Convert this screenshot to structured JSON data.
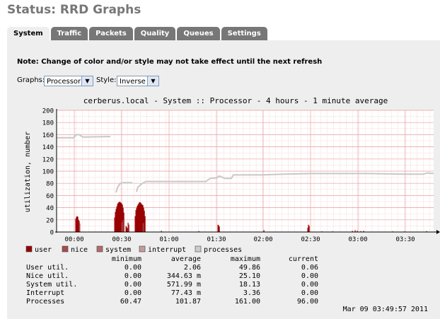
{
  "page": {
    "title": "Status: RRD Graphs"
  },
  "tabs": [
    {
      "label": "System",
      "active": true
    },
    {
      "label": "Traffic",
      "active": false
    },
    {
      "label": "Packets",
      "active": false
    },
    {
      "label": "Quality",
      "active": false
    },
    {
      "label": "Queues",
      "active": false
    },
    {
      "label": "Settings",
      "active": false
    }
  ],
  "note": "Note: Change of color and/or style may not take effect until the next refresh",
  "controls": {
    "graphs_label": "Graphs:",
    "graphs_value": "Processor",
    "style_label": "Style:",
    "style_value": "Inverse"
  },
  "graph": {
    "title": "cerberus.local - System :: Processor - 4 hours - 1 minute average",
    "ylabel": "utilization, number",
    "ymin": 0,
    "ymax": 200,
    "yticks": [
      "0",
      "20",
      "40",
      "60",
      "80",
      "100",
      "120",
      "140",
      "160",
      "180",
      "200"
    ],
    "xticks": [
      "00:00",
      "00:30",
      "01:00",
      "01:30",
      "02:00",
      "02:30",
      "03:00",
      "03:30"
    ],
    "legend": [
      {
        "label": "user",
        "color": "#990000"
      },
      {
        "label": "nice",
        "color": "#a64d4d"
      },
      {
        "label": "system",
        "color": "#b36b6b"
      },
      {
        "label": "interrupt",
        "color": "#c49a9a"
      },
      {
        "label": "processes",
        "color": "#cccccc"
      }
    ],
    "stats_headers": [
      "minimum",
      "average",
      "maximum",
      "current"
    ],
    "stats": [
      {
        "name": "User util.",
        "min": "0.00",
        "avg": "2.06",
        "max": "49.86",
        "cur": "0.06"
      },
      {
        "name": "Nice util.",
        "min": "0.00",
        "avg": "344.63 m",
        "max": "25.10",
        "cur": "0.00"
      },
      {
        "name": "System util.",
        "min": "0.00",
        "avg": "571.99 m",
        "max": "18.13",
        "cur": "0.00"
      },
      {
        "name": "Interrupt",
        "min": "0.00",
        "avg": "77.43 m",
        "max": "3.36",
        "cur": "0.00"
      },
      {
        "name": "Processes",
        "min": "60.47",
        "avg": "101.87",
        "max": "161.00",
        "cur": "96.00"
      }
    ],
    "timestamp": "Mar 09 03:49:57 2011"
  }
}
